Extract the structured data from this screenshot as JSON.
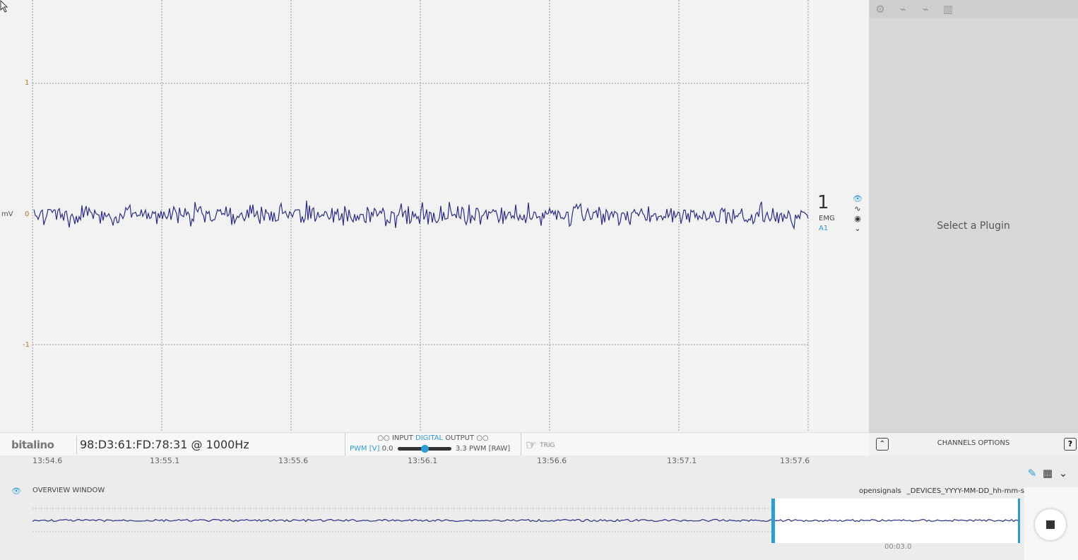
{
  "plot": {
    "y_unit": "mV",
    "y_ticks": [
      "1",
      "0",
      "-1"
    ],
    "channel": {
      "number": "1",
      "type": "EMG",
      "port": "A1"
    },
    "signal_color": "#2b2b8a"
  },
  "side_icons": [
    "eye-icon",
    "wave-icon",
    "record-dot-icon",
    "chevron-down-icon"
  ],
  "right_panel": {
    "toolbar_icons": [
      "gear-icon",
      "plug-icon",
      "plug-off-icon",
      "chart-icon"
    ],
    "message": "Select a Plugin"
  },
  "bottombar": {
    "logo": "bitalino",
    "device": "98:D3:61:FD:78:31 @ 1000Hz",
    "io": {
      "left_dots": "○○",
      "input": "INPUT",
      "digital": "DIGITAL",
      "output": "OUTPUT",
      "right_dots": "○○",
      "pwm_v": "PWM [V]",
      "min": "0.0",
      "max": "3.3",
      "pwm_raw": "PWM [RAW]",
      "slider_level": 0.5
    },
    "trig": "TRIG"
  },
  "channels_options": {
    "title": "CHANNELS OPTIONS",
    "up": "⌃",
    "help": "?"
  },
  "x_ticks": [
    "13:54.6",
    "13:55.1",
    "13:55.6",
    "13:56.1",
    "13:56.6",
    "13:57.1",
    "13:57.6"
  ],
  "overview": {
    "label": "OVERVIEW WINDOW",
    "file_prefix": "opensignals",
    "file_pattern": "_DEVICES_YYYY-MM-DD_hh-mm-ss",
    "duration": "00:03.0"
  },
  "colors": {
    "accent": "#2d9bd8",
    "signal": "#2b2b8a"
  }
}
